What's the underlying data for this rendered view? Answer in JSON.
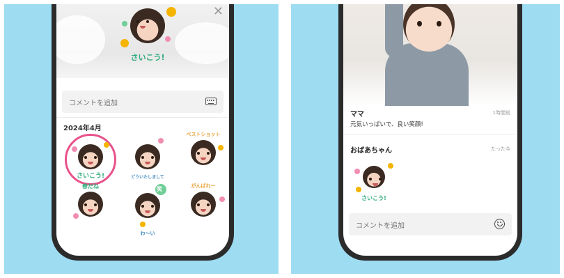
{
  "left_screen": {
    "close_icon": "close-icon",
    "hero_stamp_text": "さいこう!",
    "comment_placeholder": "コメントを追加",
    "keyboard_icon": "keyboard-icon",
    "section_date": "2024年4月",
    "stamps": [
      {
        "label": "さいこう!",
        "selected": true
      },
      {
        "label": "どういたしまして",
        "selected": false
      },
      {
        "label": "ベストショット",
        "selected": false
      },
      {
        "label": "春だね",
        "selected": false
      },
      {
        "label": "笑",
        "selected": false
      },
      {
        "label": "がんばれー",
        "selected": false
      },
      {
        "label": "わ〜い",
        "selected": false
      }
    ]
  },
  "right_screen": {
    "messages": [
      {
        "name": "ママ",
        "time": "1時間前",
        "text": "元気いっぱいで、良い笑顔!"
      },
      {
        "name": "おばあちゃん",
        "time": "たった今",
        "stamp_text": "さいこう!"
      }
    ],
    "comment_placeholder": "コメントを追加",
    "emoji_icon": "smile-icon"
  },
  "colors": {
    "background_blue": "#9edcf2",
    "phone_frame": "#2b2b2b",
    "selection_pink": "#e8528a",
    "stamp_green": "#2eaa7a",
    "stamp_yellow": "#f5b400"
  }
}
